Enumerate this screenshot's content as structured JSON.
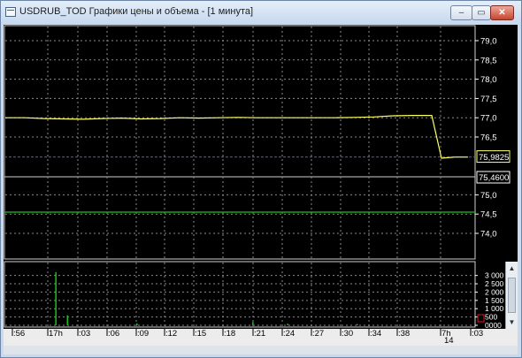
{
  "window": {
    "title": "USDRUB_TOD Графики цены и объема - [1 минута]",
    "minimize_glyph": "‒",
    "maximize_glyph": "▭",
    "close_glyph": "✕"
  },
  "price_axis": {
    "ticks": [
      "79,0",
      "78,5",
      "78,0",
      "77,5",
      "77,0",
      "76,5",
      "75,0",
      "74,5",
      "74,0"
    ],
    "current_price_label": "75,9825",
    "lower_level_label": "75,4600"
  },
  "volume_axis": {
    "ticks": [
      "3 000",
      "2 500",
      "2 000",
      "1 500",
      "1 000",
      "500",
      "0000"
    ]
  },
  "time_axis": {
    "labels": [
      ":56",
      "17h",
      ":03",
      ":06",
      ":09",
      ":12",
      ":15",
      ":18",
      ":21",
      ":24",
      ":27",
      ":30",
      ":34",
      ":38",
      "7h",
      ":03"
    ],
    "sub_label": "14"
  },
  "colors": {
    "price_line": "#ffff66",
    "current_price_line": "#3a5cff",
    "level_line": "#22c422",
    "volume_bars": "#19c419",
    "grid": "#8a8a8a",
    "background": "#000000"
  },
  "chart_data": {
    "type": "line",
    "price_series": [
      77.0,
      77.0,
      76.98,
      76.97,
      76.96,
      76.98,
      76.99,
      76.97,
      76.98,
      77.0,
      76.99,
      77.0,
      77.01,
      77.0,
      77.0,
      77.0,
      77.0,
      77.0,
      77.01,
      77.02,
      77.05,
      77.06,
      77.06,
      75.95,
      75.98,
      75.98
    ],
    "volume_series": [
      10,
      0,
      0,
      0,
      3200,
      600,
      0,
      0,
      0,
      0,
      0,
      120,
      0,
      0,
      0,
      0,
      0,
      0,
      0,
      0,
      0,
      200,
      0,
      0,
      100,
      0,
      0,
      0,
      0,
      0,
      80,
      0,
      0,
      0,
      0,
      0,
      0,
      0,
      0,
      0
    ],
    "current_price": 75.9825,
    "level_price": 74.55,
    "price_ylim": [
      73.8,
      79.2
    ],
    "volume_ylim": [
      0,
      3300
    ]
  }
}
